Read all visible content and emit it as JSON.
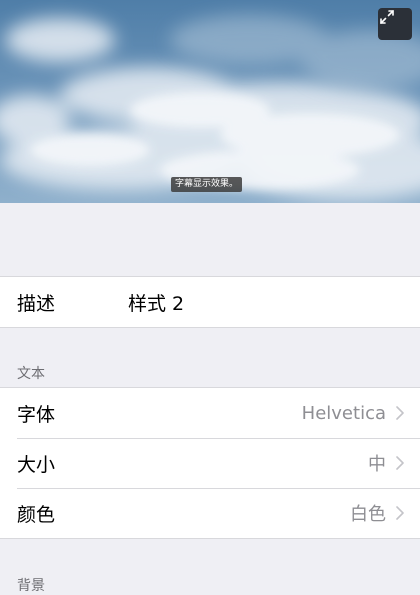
{
  "preview": {
    "caption": "字幕显示效果。",
    "expand_icon": "expand-arrows-icon"
  },
  "description_row": {
    "label": "描述",
    "value": "样式 2"
  },
  "text_section": {
    "header": "文本",
    "rows": [
      {
        "label": "字体",
        "value": "Helvetica"
      },
      {
        "label": "大小",
        "value": "中"
      },
      {
        "label": "颜色",
        "value": "白色"
      }
    ]
  },
  "background_section": {
    "header": "背景"
  },
  "colors": {
    "page_background": "#efeff4",
    "cell_background": "#ffffff",
    "secondary_text": "#8e8e93"
  }
}
